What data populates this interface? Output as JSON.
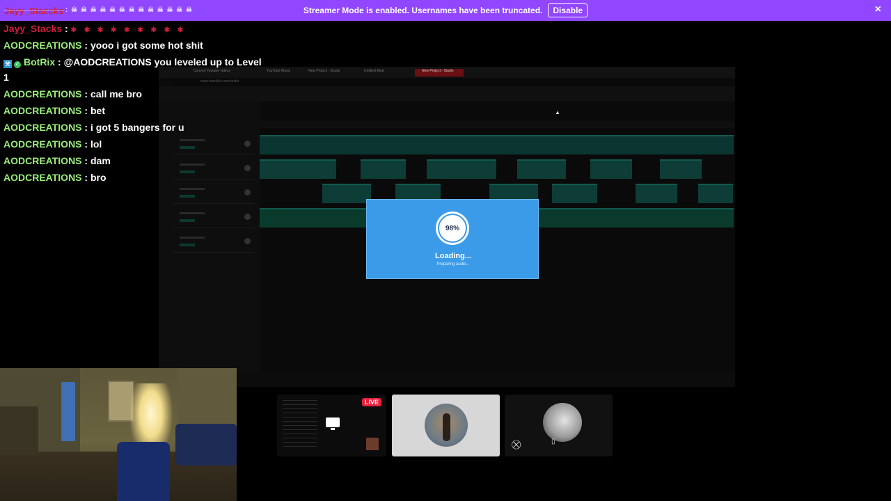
{
  "banner": {
    "message": "Streamer Mode is enabled. Usernames have been truncated.",
    "disable_label": "Disable",
    "close_icon": "×",
    "left_user": "Jayy_Staccks",
    "left_user_rest": ": ☠ ☠ ☠ ☠ ☠ ☠ ☠ ☠ ☠ ☠ ☠ ☠ ☠"
  },
  "chat": [
    {
      "user": "Jayy_Stacks",
      "sep": " : ",
      "text": "",
      "emotes": "✱ ✱ ✱ ✱ ✱ ✱ ✱ ✱ ✱",
      "color": "#cc1f3a"
    },
    {
      "user": "AODCREATIONS",
      "sep": " : ",
      "text": "yooo i got some hot shit"
    },
    {
      "user": "BotRix",
      "sep": " : ",
      "text": "@AODCREATIONS you leveled up to Level",
      "continuation": "1"
    },
    {
      "user": "AODCREATIONS",
      "sep": " : ",
      "text": "call me bro"
    },
    {
      "user": "AODCREATIONS",
      "sep": " : ",
      "text": "bet"
    },
    {
      "user": "AODCREATIONS",
      "sep": " : ",
      "text": "i got 5 bangers for u"
    },
    {
      "user": "AODCREATIONS",
      "sep": " : ",
      "text": "lol"
    },
    {
      "user": "AODCREATIONS",
      "sep": " : ",
      "text": "dam"
    },
    {
      "user": "AODCREATIONS",
      "sep": " : ",
      "text": "bro"
    }
  ],
  "capture": {
    "tabs": [
      "Convert Youtube videos",
      "YouTube Music",
      "New Project - Studio",
      "Untitled Beat",
      "New Project - Studio"
    ],
    "url": "www.bandlab.com/studio"
  },
  "loading": {
    "percent": "98%",
    "percent_value": 98,
    "title": "Loading...",
    "subtitle": "Preparing audio..."
  },
  "tiles": {
    "live_label": "LIVE"
  },
  "colors": {
    "banner": "#9146ff",
    "loading_card": "#3b9be8",
    "username_green": "#9aef7a",
    "username_red": "#cc1f3a",
    "live_red": "#e91e3c"
  },
  "icons": {
    "bot": "bot-badge-icon",
    "verified": "verified-check-icon",
    "close": "close-icon",
    "monitor": "monitor-icon",
    "mic_muted": "mic-muted-icon"
  }
}
